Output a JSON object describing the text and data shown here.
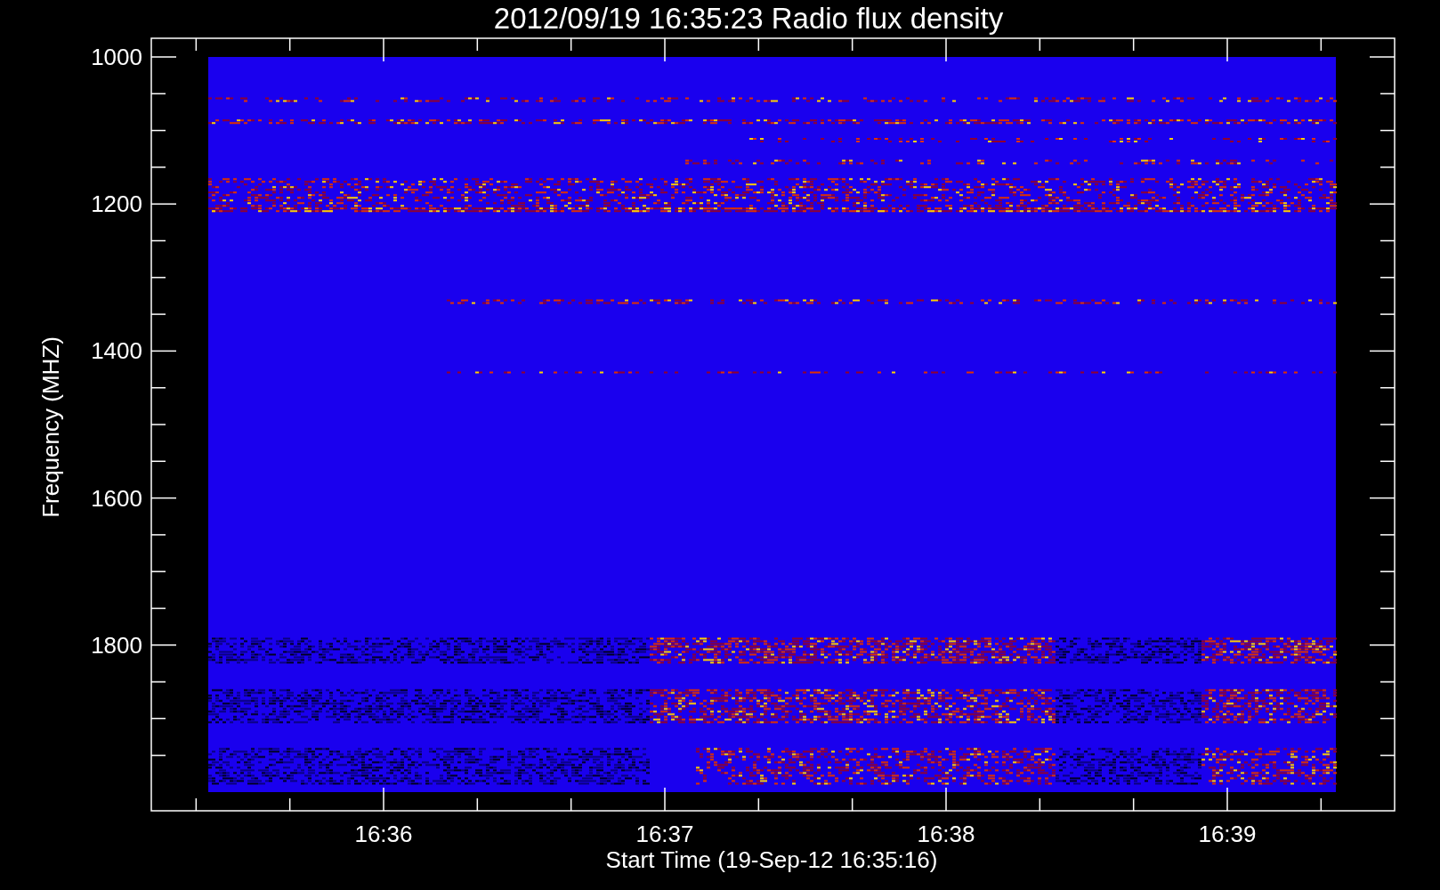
{
  "chart": {
    "title": "2012/09/19 16:35:23 Radio flux density",
    "ylabel": "Frequency (MHZ)",
    "xlabel": "Start Time (19-Sep-12 16:35:16)",
    "yticks": [
      "1000",
      "1200",
      "1400",
      "1600",
      "1800"
    ],
    "xticks": [
      "16:36",
      "16:37",
      "16:38",
      "16:39"
    ]
  }
}
